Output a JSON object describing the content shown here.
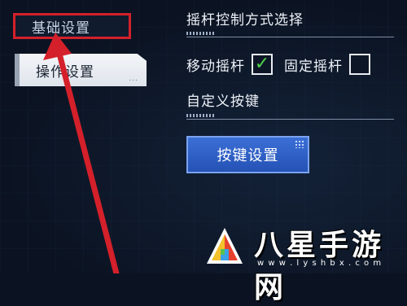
{
  "tabs": {
    "basic_settings": "基础设置",
    "operation_settings": "操作设置",
    "operation_dots": "..."
  },
  "joystick": {
    "title": "摇杆控制方式选择",
    "options": [
      {
        "label": "移动摇杆",
        "checked": true
      },
      {
        "label": "固定摇杆",
        "checked": false
      }
    ]
  },
  "custom_keys": {
    "title": "自定义按键",
    "button_label": "按键设置"
  },
  "watermark": {
    "name": "八星手游网",
    "url": "w w w . l y s h b x . c o m"
  },
  "colors": {
    "highlight_box": "#d4202a",
    "arrow": "#d4202a",
    "check": "#4fd14a",
    "button": "#2f62c8"
  },
  "icons": [
    "check-mark-icon",
    "red-arrow-annotation",
    "watermark-logo"
  ]
}
